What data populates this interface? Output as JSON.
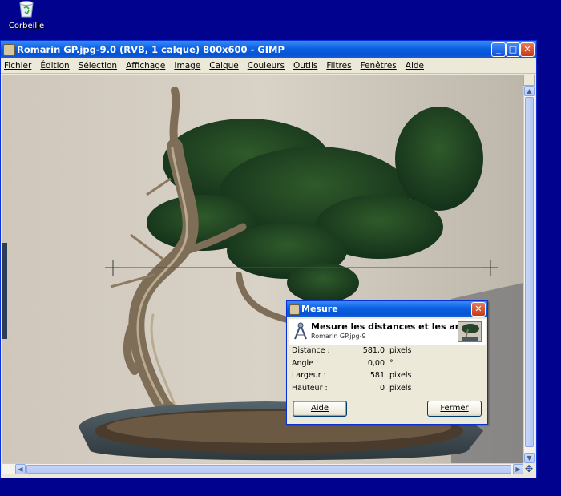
{
  "desktop": {
    "recycle_bin_label": "Corbeille"
  },
  "window": {
    "title": "Romarin GP.jpg-9.0 (RVB, 1 calque) 800x600 - GIMP",
    "menu": [
      "Fichier",
      "Édition",
      "Sélection",
      "Affichage",
      "Image",
      "Calque",
      "Couleurs",
      "Outils",
      "Filtres",
      "Fenêtres",
      "Aide"
    ],
    "controls": {
      "minimize": "_",
      "maximize": "□",
      "close": "✕"
    }
  },
  "dialog": {
    "title": "Mesure",
    "heading": "Mesure les distances et les angles",
    "subheading": "Romarin GP.jpg-9",
    "rows": [
      {
        "label": "Distance :",
        "value": "581,0",
        "unit": "pixels"
      },
      {
        "label": "Angle :",
        "value": "0,00",
        "unit": "°"
      },
      {
        "label": "Largeur :",
        "value": "581",
        "unit": "pixels"
      },
      {
        "label": "Hauteur :",
        "value": "0",
        "unit": "pixels"
      }
    ],
    "help_button": "Aide",
    "close_button": "Fermer"
  },
  "colors": {
    "desktop": "#01028e",
    "titlebar": "#0a5fe0",
    "measure_line": "#2b6a2b"
  }
}
